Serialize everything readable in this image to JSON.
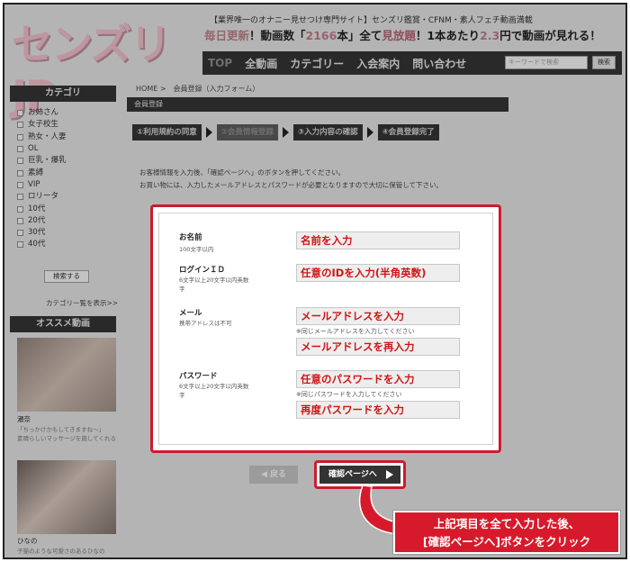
{
  "header": {
    "logo_text": "センズリJP",
    "tagline": "【業界唯一のオナニー見せつけ専門サイト】センズリ鑑賞・CFNM・素人フェチ動画満載",
    "promo": {
      "part1": "毎日更新",
      "part2": "！動画数「",
      "count": "2166",
      "part3": "本」全て",
      "part4": "見放題",
      "part5": "！1本あたり",
      "price": "2.3",
      "part6": "円で動画が見れる！"
    },
    "nav": [
      "TOP",
      "全動画",
      "カテゴリー",
      "入会案内",
      "問い合わせ"
    ],
    "search_placeholder": "キーワードで検索",
    "search_button": "検索"
  },
  "sidebar": {
    "category_title": "カテゴリ",
    "categories": [
      "お姉さん",
      "女子校生",
      "熟女・人妻",
      "OL",
      "巨乳・爆乳",
      "素縛",
      "VIP",
      "ロリータ",
      "10代",
      "20代",
      "30代",
      "40代"
    ],
    "search_button": "検索する",
    "category_list_link": "カテゴリー覧を表示>>",
    "recommend_title": "オススメ動画",
    "videos": [
      {
        "title": "瀬奈",
        "snippet1": "「ちっかけかもしてきますね〜」",
        "snippet2": "素晴らしいマッサージを施してくれる若妻エステの女性さん、字幕の"
      },
      {
        "title": "ひなの",
        "snippet1": "子猫のような可愛さのあるひなの"
      }
    ]
  },
  "main": {
    "breadcrumb": "HOME >　会員登録（入力フォーム）",
    "section_title": "会員登録",
    "steps": [
      "①利用規約の同意",
      "②会員情報登録",
      "③入力内容の確認",
      "④会員登録完了"
    ],
    "intro_line1": "お客様情報を入力後、「確認ページへ」のボタンを押してください。",
    "intro_line2": "お買い物には、入力したメールアドレスとパスワードが必要となりますので大切に保管して下さい。"
  },
  "form": {
    "name_label": "お名前",
    "name_sub": "100文字以内",
    "name_value": "名前を入力",
    "login_label": "ログインＩＤ",
    "login_sub1": "6文字以上20文字以内英数",
    "login_sub2": "字",
    "login_value": "任意のIDを入力(半角英数)",
    "mail_label": "メール",
    "mail_sub": "携帯アドレスは不可",
    "mail_value": "メールアドレスを入力",
    "mail_note": "※同じメールアドレスを入力してください",
    "mail_confirm_value": "メールアドレスを再入力",
    "pass_label": "パスワード",
    "pass_sub1": "6文字以上20文字以内英数",
    "pass_sub2": "字",
    "pass_value": "任意のパスワードを入力",
    "pass_note": "※同じパスワードを入力してください",
    "pass_confirm_value": "再度パスワードを入力"
  },
  "buttons": {
    "back_label": "◀ 戻る",
    "confirm_label": "確認ページへ"
  },
  "callout": {
    "line1": "上記項目を全て入力した後、",
    "line2": "[確認ページへ]ボタンをクリック"
  },
  "colors": {
    "highlight": "#cc1c2c",
    "dark_bar": "#333333",
    "field_text": "#d01515"
  }
}
